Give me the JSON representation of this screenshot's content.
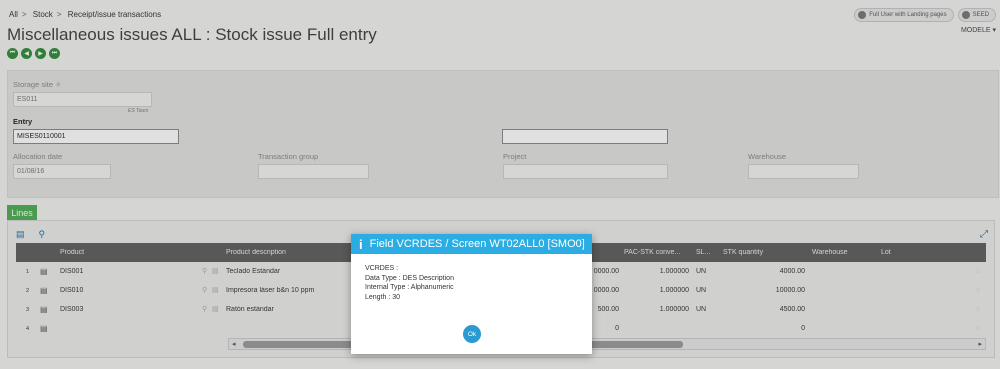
{
  "breadcrumb": [
    "All",
    "Stock",
    "Receipt/issue transactions"
  ],
  "topright": {
    "btn1": "Full User with Landing pages",
    "btn2": "SEED",
    "modele": "MODELE"
  },
  "page": {
    "title": "Miscellaneous issues ALL : Stock issue Full entry"
  },
  "header": {
    "storage_site_label": "Storage site",
    "storage_site_value": "ES011",
    "storage_site_sub": "ES Tours",
    "entry_label": "Entry",
    "entry_value": "MISES0110001",
    "extra_value": "",
    "allocation_label": "Allocation date",
    "allocation_value": "01/08/16",
    "group_label": "Transaction group",
    "group_value": "",
    "project_label": "Project",
    "project_value": "",
    "warehouse_label": "Warehouse",
    "warehouse_value": ""
  },
  "lines": {
    "tab": "Lines",
    "columns": [
      "Product",
      "Product description",
      "PAC-STK conve...",
      "SL...",
      "STK quantity",
      "Warehouse",
      "Lot"
    ],
    "rows": [
      {
        "num": "1",
        "product": "DIS001",
        "description": "Teclado Estándar",
        "hidden": "0000.00",
        "conv": "1.000000",
        "unit": "UN",
        "qty": "4000.00"
      },
      {
        "num": "2",
        "product": "DIS010",
        "description": "Impresora láser b&n 10 ppm",
        "hidden": "0000.00",
        "conv": "1.000000",
        "unit": "UN",
        "qty": "10000.00"
      },
      {
        "num": "3",
        "product": "DIS003",
        "description": "Ratón estándar",
        "hidden": "500.00",
        "conv": "1.000000",
        "unit": "UN",
        "qty": "4500.00"
      },
      {
        "num": "4",
        "product": "",
        "description": "",
        "hidden": "0",
        "conv": "",
        "unit": "",
        "qty": "0"
      }
    ]
  },
  "dialog": {
    "title": "Field VCRDES / Screen WT02ALL0 [SMO0]",
    "line1": "VCRDES :",
    "line2": "Data Type : DES Description",
    "line3": "Internal Type : Alphanumeric",
    "line4": "Length : 30",
    "ok": "Ok"
  },
  "colors": {
    "accent": "#2bace2",
    "green": "#4caf50",
    "header_dark": "#5e5e5e"
  }
}
